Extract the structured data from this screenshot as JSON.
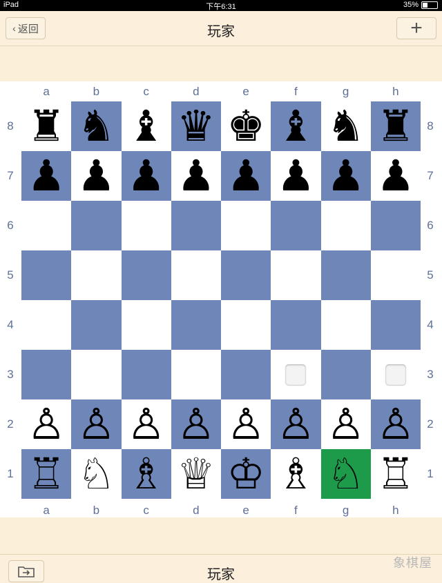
{
  "status_bar": {
    "device": "iPad",
    "time": "下午6:31",
    "battery": "35%",
    "battery_level": 0.35
  },
  "nav": {
    "back_label": "返回",
    "title": "玩家",
    "add_label": "+"
  },
  "board": {
    "files": [
      "a",
      "b",
      "c",
      "d",
      "e",
      "f",
      "g",
      "h"
    ],
    "ranks": [
      "8",
      "7",
      "6",
      "5",
      "4",
      "3",
      "2",
      "1"
    ],
    "colors": {
      "light": "#ffffff",
      "dark": "#6e87b8",
      "highlight": "#1e9a4b"
    },
    "highlight_square": "g1",
    "move_markers": [
      "f3",
      "h3"
    ],
    "position": [
      [
        "♜",
        "♞",
        "♝",
        "♛",
        "♚",
        "♝",
        "♞",
        "♜"
      ],
      [
        "♟",
        "♟",
        "♟",
        "♟",
        "♟",
        "♟",
        "♟",
        "♟"
      ],
      [
        "",
        "",
        "",
        "",
        "",
        "",
        "",
        ""
      ],
      [
        "",
        "",
        "",
        "",
        "",
        "",
        "",
        ""
      ],
      [
        "",
        "",
        "",
        "",
        "",
        "",
        "",
        ""
      ],
      [
        "",
        "",
        "",
        "",
        "",
        "",
        "",
        ""
      ],
      [
        "♙",
        "♙",
        "♙",
        "♙",
        "♙",
        "♙",
        "♙",
        "♙"
      ],
      [
        "♖",
        "♘",
        "♗",
        "♕",
        "♔",
        "♗",
        "♘",
        "♖"
      ]
    ]
  },
  "bottom": {
    "title": "玩家",
    "watermark": "象棋屋"
  }
}
